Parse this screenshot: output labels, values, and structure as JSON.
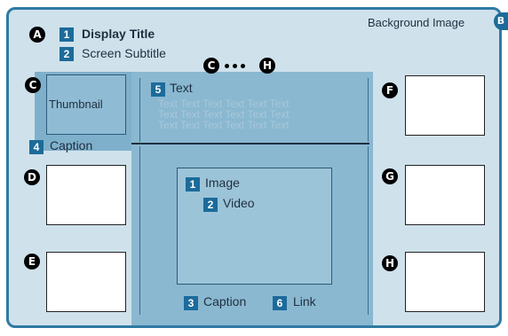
{
  "markers": {
    "a": "A",
    "b": "B",
    "c": "C",
    "d": "D",
    "e": "E",
    "f": "F",
    "g": "G",
    "h": "H"
  },
  "header": {
    "title_num": "1",
    "title": "Display Title",
    "subtitle_num": "2",
    "subtitle": "Screen Subtitle",
    "background_label": "Background Image"
  },
  "thumbnail": {
    "label": "Thumbnail",
    "caption_num": "4",
    "caption": "Caption"
  },
  "text_panel": {
    "num": "5",
    "title": "Text",
    "lines": [
      "Text Text Text Text Text Text",
      "Text Text Text Text Text Text",
      "Text Text Text Text Text Text"
    ]
  },
  "media_panel": {
    "image_num": "1",
    "image": "Image",
    "video_num": "2",
    "video": "Video",
    "caption_num": "3",
    "caption": "Caption",
    "link_num": "6",
    "link": "Link"
  },
  "colors": {
    "frame_bg": "#cfe2ec",
    "frame_border": "#2f7aa3",
    "panel": "#8ab8d1",
    "panel_dark": "#7fb0cb",
    "badge": "#1c6b9a"
  }
}
